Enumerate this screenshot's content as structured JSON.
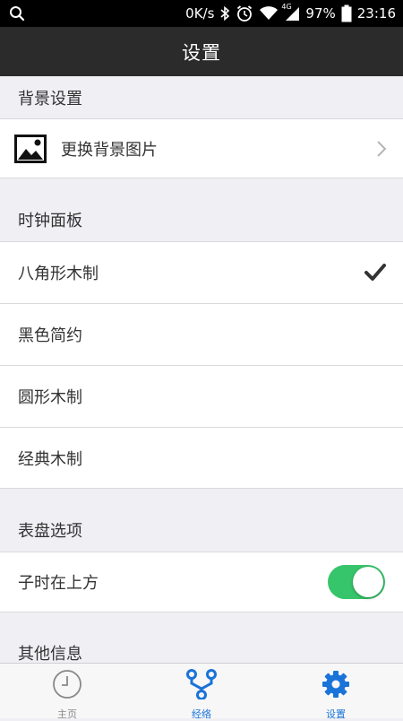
{
  "status_bar": {
    "net_speed": "0K/s",
    "signal_badge": "4G",
    "battery": "97%",
    "time": "23:16"
  },
  "nav": {
    "title": "设置"
  },
  "sections": {
    "background": {
      "header": "背景设置",
      "change_image_label": "更换背景图片"
    },
    "clock_panel": {
      "header": "时钟面板",
      "options": [
        "八角形木制",
        "黑色简约",
        "圆形木制",
        "经典木制"
      ],
      "selected": "八角形木制"
    },
    "dial": {
      "header": "表盘选项",
      "option_label": "子时在上方",
      "option_on": true
    },
    "other": {
      "header": "其他信息"
    }
  },
  "tabbar": {
    "home": "主页",
    "meridian": "经络",
    "settings": "设置",
    "active_color": "#1a73d9",
    "inactive_color": "#888888"
  },
  "colors": {
    "toggle_on": "#37c56b",
    "navbar": "#2b2b2b"
  }
}
